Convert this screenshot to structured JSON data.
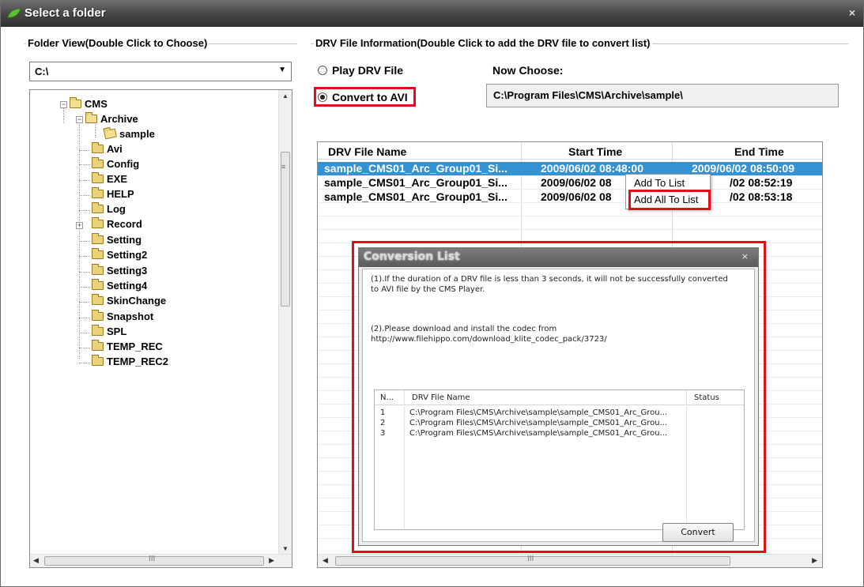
{
  "window": {
    "title": "Select a folder",
    "close_glyph": "×"
  },
  "left_panel": {
    "group_title": "Folder View(Double Click to Choose)",
    "drive_combo": {
      "value": "C:\\"
    },
    "tree": [
      {
        "label": "CMS",
        "icon": "folder-open-icon"
      },
      {
        "label": "Archive",
        "icon": "folder-open-icon"
      },
      {
        "label": "sample",
        "icon": "folder-selected-icon"
      },
      {
        "label": "Avi",
        "icon": "folder-icon"
      },
      {
        "label": "Config",
        "icon": "folder-icon"
      },
      {
        "label": "EXE",
        "icon": "folder-icon"
      },
      {
        "label": "HELP",
        "icon": "folder-icon"
      },
      {
        "label": "Log",
        "icon": "folder-icon"
      },
      {
        "label": "Record",
        "icon": "folder-icon"
      },
      {
        "label": "Setting",
        "icon": "folder-icon"
      },
      {
        "label": "Setting2",
        "icon": "folder-icon"
      },
      {
        "label": "Setting3",
        "icon": "folder-icon"
      },
      {
        "label": "Setting4",
        "icon": "folder-icon"
      },
      {
        "label": "SkinChange",
        "icon": "folder-icon"
      },
      {
        "label": "Snapshot",
        "icon": "folder-icon"
      },
      {
        "label": "SPL",
        "icon": "folder-icon"
      },
      {
        "label": "TEMP_REC",
        "icon": "folder-icon"
      },
      {
        "label": "TEMP_REC2",
        "icon": "folder-icon"
      }
    ]
  },
  "right_panel": {
    "group_title": "DRV File Information(Double Click to add the DRV file to convert list)",
    "play_option": "Play DRV File",
    "convert_option": "Convert  to AVI",
    "now_choose_label": "Now Choose:",
    "now_choose_path": "C:\\Program Files\\CMS\\Archive\\sample\\",
    "file_list": {
      "columns": [
        "DRV File Name",
        "Start Time",
        "End Time"
      ],
      "rows": [
        {
          "name": "sample_CMS01_Arc_Group01_Si...",
          "start": "2009/06/02 08:48:00",
          "end": "2009/06/02 08:50:09"
        },
        {
          "name": "sample_CMS01_Arc_Group01_Si...",
          "start": "2009/06/02 08",
          "end": "/02 08:52:19"
        },
        {
          "name": "sample_CMS01_Arc_Group01_Si...",
          "start": "2009/06/02 08",
          "end": "/02 08:53:18"
        }
      ]
    },
    "context_menu": {
      "add_to_list": "Add To List",
      "add_all_to_list": "Add All To List"
    }
  },
  "conversion_dialog": {
    "title": "Conversion List",
    "close_glyph": "×",
    "note1_line1": "(1).If the duration of a DRV file is less than 3 seconds, it will not be successfully converted",
    "note1_line2": "to AVI file by the CMS Player.",
    "note2_line1": "(2).Please download and install the codec from",
    "note2_line2": "http://www.filehippo.com/download_klite_codec_pack/3723/",
    "columns": [
      "N...",
      "DRV File Name",
      "Status"
    ],
    "rows": [
      {
        "n": "1",
        "path": "C:\\Program Files\\CMS\\Archive\\sample\\sample_CMS01_Arc_Grou...",
        "status": ""
      },
      {
        "n": "2",
        "path": "C:\\Program Files\\CMS\\Archive\\sample\\sample_CMS01_Arc_Grou...",
        "status": ""
      },
      {
        "n": "3",
        "path": "C:\\Program Files\\CMS\\Archive\\sample\\sample_CMS01_Arc_Grou...",
        "status": ""
      }
    ],
    "convert_button": "Convert"
  },
  "colors": {
    "highlight_border": "#e0101a",
    "selection": "#3492d3",
    "titlebar": "#3f3f3f"
  }
}
